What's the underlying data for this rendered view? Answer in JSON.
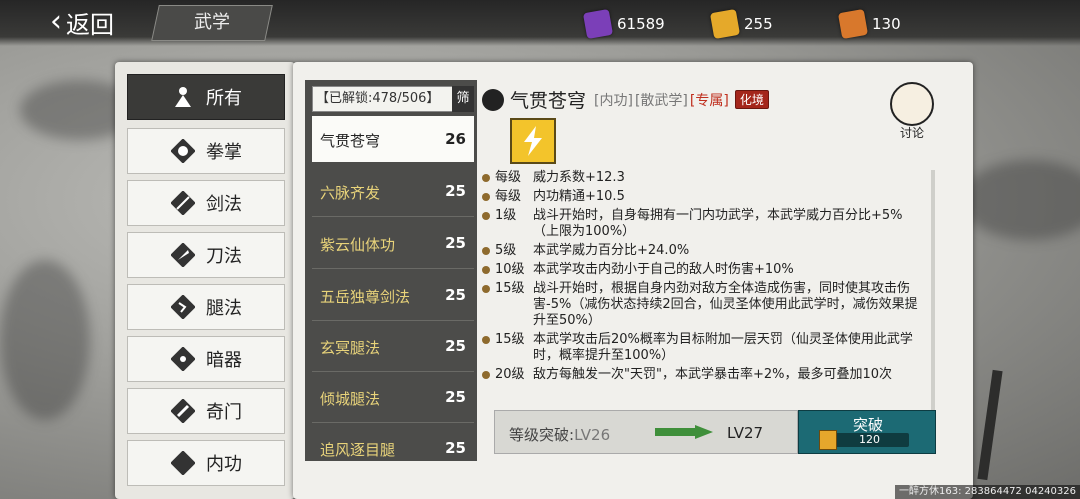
{
  "header": {
    "back_label": "返回",
    "title": "武学"
  },
  "resources": [
    {
      "icon": "purple-scroll-icon",
      "value": "61589",
      "color": "#7b3fb8"
    },
    {
      "icon": "gold-scroll-icon",
      "value": "255",
      "color": "#e5a92a"
    },
    {
      "icon": "orange-scroll-icon",
      "value": "130",
      "color": "#d8782c"
    }
  ],
  "categories": [
    {
      "label": "所有",
      "icon": "figure-icon",
      "selected": true
    },
    {
      "label": "拳掌",
      "icon": "fist-icon"
    },
    {
      "label": "剑法",
      "icon": "sword-icon"
    },
    {
      "label": "刀法",
      "icon": "blade-icon"
    },
    {
      "label": "腿法",
      "icon": "kick-icon"
    },
    {
      "label": "暗器",
      "icon": "shuriken-icon"
    },
    {
      "label": "奇门",
      "icon": "staff-icon"
    },
    {
      "label": "内功",
      "icon": "inner-icon"
    }
  ],
  "list": {
    "unlock_text": "【已解锁:478/506】",
    "filter_label": "筛",
    "skills": [
      {
        "name": "气贯苍穹",
        "level": "26",
        "selected": true
      },
      {
        "name": "六脉齐发",
        "level": "25"
      },
      {
        "name": "紫云仙体功",
        "level": "25"
      },
      {
        "name": "五岳独尊剑法",
        "level": "25"
      },
      {
        "name": "玄冥腿法",
        "level": "25"
      },
      {
        "name": "倾城腿法",
        "level": "25"
      },
      {
        "name": "追风逐目腿",
        "level": "25"
      }
    ]
  },
  "detail": {
    "name": "气贯苍穹",
    "tag1": "[内功]",
    "tag2": "[散武学]",
    "tag3": "[专属]",
    "realm": "化境",
    "discuss_label": "讨论",
    "effects": [
      {
        "level": "每级",
        "text": "威力系数+12.3"
      },
      {
        "level": "每级",
        "text": "内功精通+10.5"
      },
      {
        "level": "1级",
        "text": "战斗开始时，自身每拥有一门内功武学，本武学威力百分比+5%（上限为100%）"
      },
      {
        "level": "5级",
        "text": "本武学威力百分比+24.0%"
      },
      {
        "level": "10级",
        "text": "本武学攻击内劲小于自己的敌人时伤害+10%"
      },
      {
        "level": "15级",
        "text": "战斗开始时，根据自身内劲对敌方全体造成伤害，同时使其攻击伤害-5%（减伤状态持续2回合，仙灵圣体使用此武学时，减伤效果提升至50%）"
      },
      {
        "level": "15级",
        "text": "本武学攻击后20%概率为目标附加一层天罚（仙灵圣体使用此武学时，概率提升至100%）"
      },
      {
        "level": "20级",
        "text": "敌方每触发一次\"天罚\"，本武学暴击率+2%，最多可叠加10次"
      }
    ],
    "upgrade": {
      "label": "等级突破:",
      "from": "LV26",
      "to": "LV27",
      "button": "突破",
      "cost": "120"
    }
  },
  "footer": "一醉方休163: 283864472   04240326"
}
